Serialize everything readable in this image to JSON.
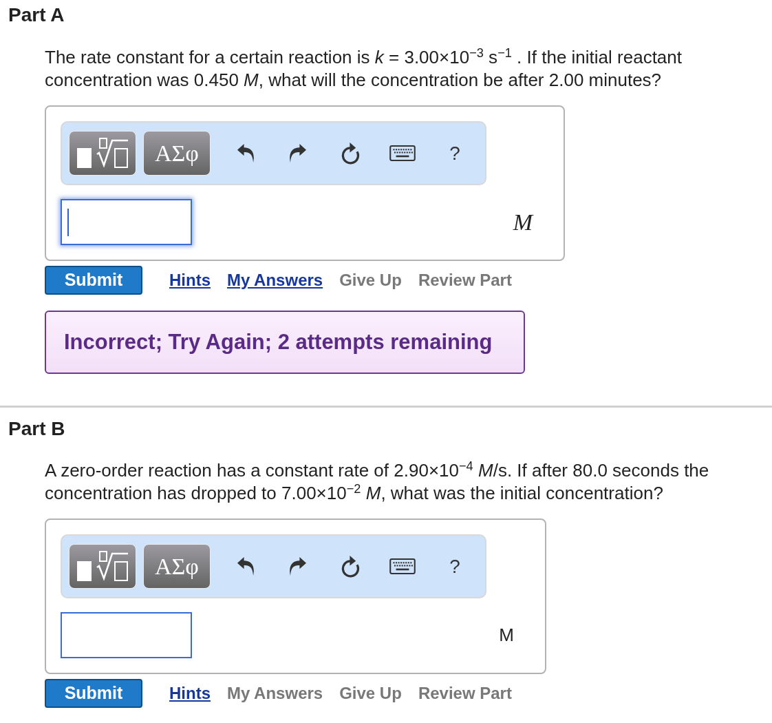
{
  "parts": [
    {
      "title": "Part A",
      "question": "The rate constant for a certain reaction is *k* = 3.00×10$^{−3}$ s$^{−1}$ . If the initial reactant concentration was 0.450 *M*, what will the concentration be after 2.00 minutes?",
      "toolbar": {
        "symbols_label": "ΑΣφ",
        "help_label": "?"
      },
      "answer": {
        "focused": true,
        "unit": {
          "kind": "math",
          "text": "M"
        }
      },
      "submit_label": "Submit",
      "links": [
        {
          "label": "Hints",
          "disabled": false
        },
        {
          "label": "My Answers",
          "disabled": false
        },
        {
          "label": "Give Up",
          "disabled": true
        },
        {
          "label": "Review Part",
          "disabled": true
        }
      ],
      "feedback": "Incorrect; Try Again; 2 attempts remaining"
    },
    {
      "title": "Part B",
      "question": "A zero-order reaction has a constant rate of 2.90×10$^{−4}$ *M*/s. If after 80.0 seconds the concentration has dropped to 7.00×10$^{−2}$ *M*, what was the initial concentration?",
      "toolbar": {
        "symbols_label": "ΑΣφ",
        "help_label": "?"
      },
      "answer": {
        "focused": false,
        "unit": {
          "kind": "text",
          "text": "M"
        }
      },
      "submit_label": "Submit",
      "links": [
        {
          "label": "Hints",
          "disabled": false
        },
        {
          "label": "My Answers",
          "disabled": true
        },
        {
          "label": "Give Up",
          "disabled": true
        },
        {
          "label": "Review Part",
          "disabled": true
        }
      ]
    }
  ]
}
